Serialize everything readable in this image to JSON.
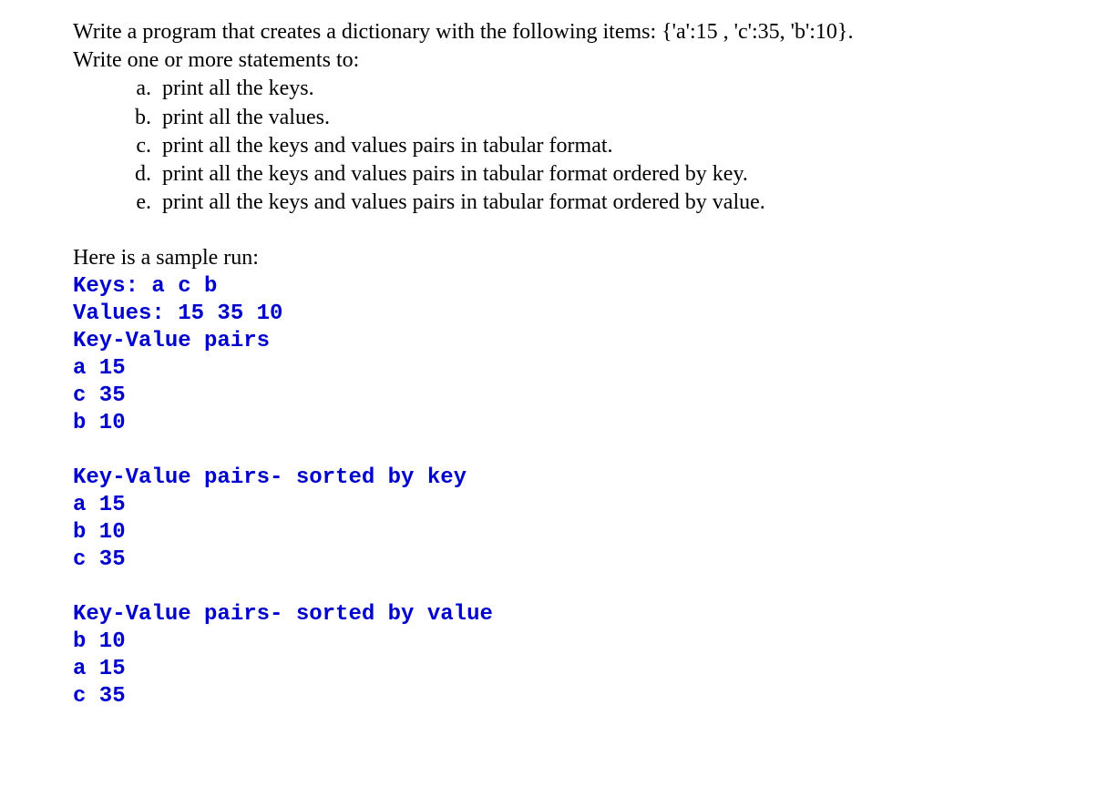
{
  "intro": {
    "line1": "Write a program that creates a dictionary with the following items: {'a':15 , 'c':35, 'b':10}.",
    "line2": " Write one or more statements to:"
  },
  "items": {
    "a": {
      "marker": "a.",
      "text": "print all the keys."
    },
    "b": {
      "marker": "b.",
      "text": "print all the values."
    },
    "c": {
      "marker": "c.",
      "text": "print all the keys and values pairs in tabular format."
    },
    "d": {
      "marker": "d.",
      "text": "print all the keys and values pairs in tabular format ordered by key."
    },
    "e": {
      "marker": "e.",
      "text": "print all the keys and values pairs in tabular format ordered by value."
    }
  },
  "sample_header": "Here is a sample run:",
  "output": {
    "block1": "Keys: a c b\nValues: 15 35 10\nKey-Value pairs\na 15\nc 35\nb 10",
    "block2": "Key-Value pairs- sorted by key\na 15\nb 10\nc 35",
    "block3": "Key-Value pairs- sorted by value\nb 10\na 15\nc 35"
  }
}
